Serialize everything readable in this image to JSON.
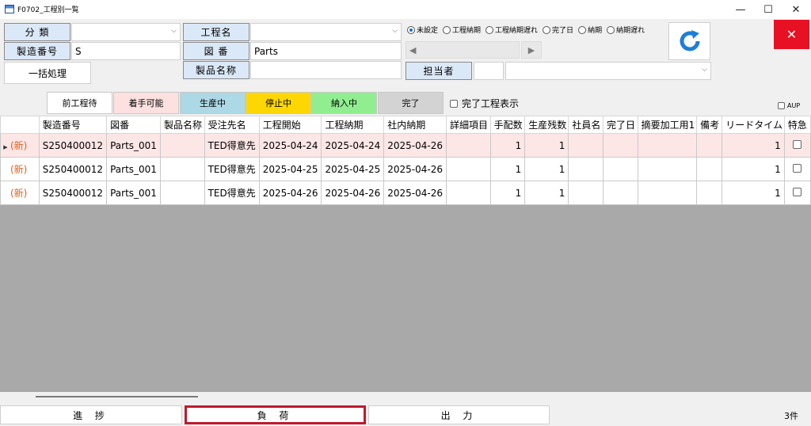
{
  "window": {
    "title": "F0702_工程別一覧",
    "minimize": "—",
    "maximize": "☐",
    "close": "✕"
  },
  "filters": {
    "category_label": "分 類",
    "category_value": "",
    "mfg_no_label": "製造番号",
    "mfg_no_value": "S",
    "process_label": "工程名",
    "process_value": "",
    "drawing_label": "図 番",
    "drawing_value": "Parts",
    "product_label": "製品名称",
    "product_value": "",
    "person_label": "担当者",
    "person_value": "",
    "batch_button": "一括処理"
  },
  "radios": [
    {
      "label": "未設定",
      "checked": true
    },
    {
      "label": "工程納期",
      "checked": false
    },
    {
      "label": "工程納期遅れ",
      "checked": false
    },
    {
      "label": "完了日",
      "checked": false
    },
    {
      "label": "納期",
      "checked": false
    },
    {
      "label": "納期遅れ",
      "checked": false
    }
  ],
  "nav": {
    "prev": "◀",
    "next": "▶"
  },
  "legend": [
    {
      "label": "前工程待",
      "color": "#ffffff"
    },
    {
      "label": "着手可能",
      "color": "#fde0e0"
    },
    {
      "label": "生産中",
      "color": "#add8e6"
    },
    {
      "label": "停止中",
      "color": "#ffd700"
    },
    {
      "label": "納入中",
      "color": "#90ee90"
    },
    {
      "label": "完了",
      "color": "#d3d3d3"
    }
  ],
  "show_completed_label": "完了工程表示",
  "aup_label": "AUP",
  "table": {
    "headers": [
      "製造番号",
      "図番",
      "製品名称",
      "受注先名",
      "工程開始",
      "工程納期",
      "社内納期",
      "詳細項目",
      "手配数",
      "生産残数",
      "社員名",
      "完了日",
      "摘要加工用1",
      "備考",
      "リードタイム",
      "特急"
    ],
    "rows": [
      {
        "tag": "(新)",
        "cells": [
          "S250400012",
          "Parts_001",
          "",
          "TED得意先",
          "2025-04-24",
          "2025-04-24",
          "2025-04-26",
          "",
          "1",
          "1",
          "",
          "",
          "",
          "",
          "1",
          ""
        ]
      },
      {
        "tag": "(新)",
        "cells": [
          "S250400012",
          "Parts_001",
          "",
          "TED得意先",
          "2025-04-25",
          "2025-04-25",
          "2025-04-26",
          "",
          "1",
          "1",
          "",
          "",
          "",
          "",
          "1",
          ""
        ]
      },
      {
        "tag": "(新)",
        "cells": [
          "S250400012",
          "Parts_001",
          "",
          "TED得意先",
          "2025-04-26",
          "2025-04-26",
          "2025-04-26",
          "",
          "1",
          "1",
          "",
          "",
          "",
          "",
          "1",
          ""
        ]
      }
    ]
  },
  "bottom": {
    "progress": "進 捗",
    "load": "負 荷",
    "output": "出 力",
    "count": "3件"
  },
  "colors": {
    "selected_row": "#fde6e6",
    "highlight_border": "#c0192c",
    "close_red": "#e81123",
    "refresh_blue": "#1e7fd6"
  }
}
